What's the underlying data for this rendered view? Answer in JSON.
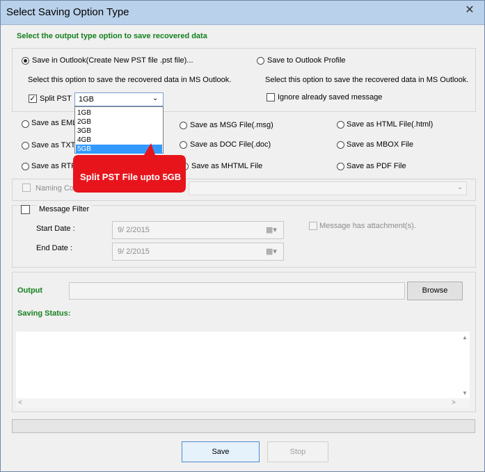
{
  "window": {
    "title": "Select Saving Option Type",
    "close_icon": "close-icon"
  },
  "header": {
    "text": "Select the output type option to save recovered data"
  },
  "outlook": {
    "save_in_outlook_label": "Save in Outlook(Create New PST file .pst file)...",
    "save_in_outlook_desc": "Select this option to save the recovered data in MS Outlook.",
    "save_to_profile_label": "Save to Outlook Profile",
    "save_to_profile_desc": "Select this option to save the recovered data in MS Outlook.",
    "split_pst_label": "Split PST",
    "split_pst_value": "1GB",
    "split_options": [
      "1GB",
      "2GB",
      "3GB",
      "4GB",
      "5GB"
    ],
    "split_selected_index": 4,
    "ignore_label": "Ignore already saved message"
  },
  "tooltip": {
    "text": "Split PST File upto 5GB"
  },
  "formats": {
    "eml": "Save as EML",
    "txt": "Save as TXT",
    "rtf": "Save as RTF",
    "msg": "Save as MSG File(.msg)",
    "doc": "Save as DOC File(.doc)",
    "mhtml": "Save as MHTML File",
    "html": "Save as HTML File(.html)",
    "mbox": "Save as MBOX File",
    "pdf": "Save as PDF File"
  },
  "naming": {
    "label": "Naming Co"
  },
  "filter": {
    "label": "Message Filter",
    "start_label": "Start Date :",
    "start_value": "9/  2/2015",
    "end_label": "End Date :",
    "end_value": "9/  2/2015",
    "attachment_label": "Message has attachment(s)."
  },
  "output": {
    "label": "Output",
    "path": "",
    "browse_label": "Browse",
    "status_label": "Saving Status:",
    "progress": 0
  },
  "actions": {
    "save_label": "Save",
    "stop_label": "Stop"
  },
  "colors": {
    "accent_green": "#15801d",
    "tooltip_red": "#e8141b",
    "selection_blue": "#3399ff"
  }
}
